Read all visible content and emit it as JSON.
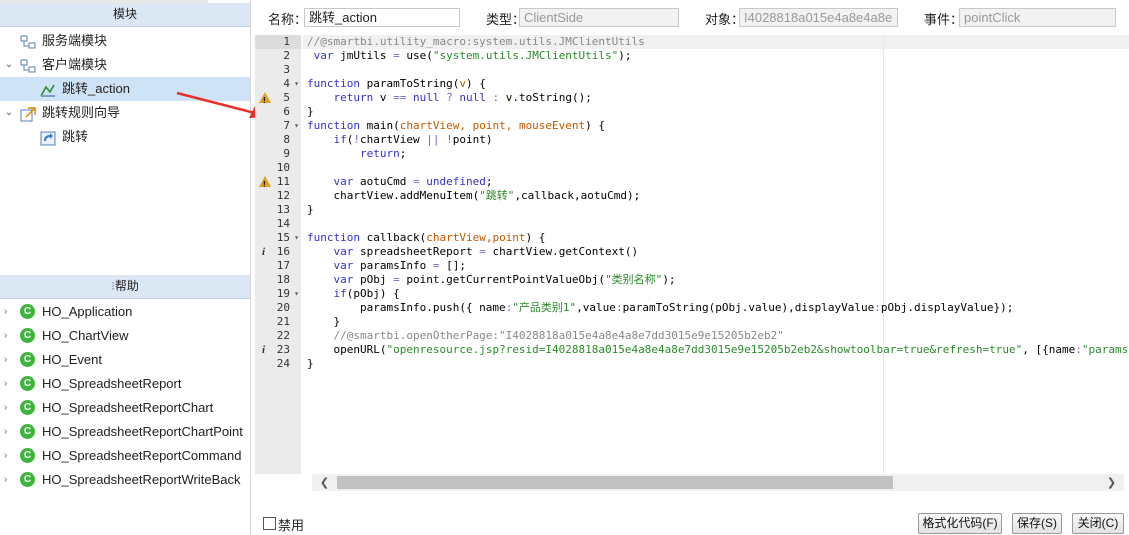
{
  "left_panel": {
    "module_header": "模块",
    "tree": [
      {
        "label": "服务端模块",
        "icon": "server-module-icon"
      },
      {
        "label": "客户端模块",
        "icon": "client-module-icon",
        "expanded": true
      },
      {
        "label": "跳转_action",
        "icon": "action-icon",
        "selected": true
      },
      {
        "label": "跳转规则向导",
        "icon": "wizard-icon",
        "expanded": true
      },
      {
        "label": "跳转",
        "icon": "jump-icon"
      }
    ],
    "help_header": "帮助",
    "help_items": [
      {
        "label": "HO_Application"
      },
      {
        "label": "HO_ChartView"
      },
      {
        "label": "HO_Event"
      },
      {
        "label": "HO_SpreadsheetReport"
      },
      {
        "label": "HO_SpreadsheetReportChart"
      },
      {
        "label": "HO_SpreadsheetReportChartPoint"
      },
      {
        "label": "HO_SpreadsheetReportCommand"
      },
      {
        "label": "HO_SpreadsheetReportWriteBack"
      }
    ],
    "help_badge": "C"
  },
  "fields": {
    "name_label": "名称：",
    "name_value": "跳转_action",
    "type_label": "类型：",
    "type_value": "ClientSide",
    "object_label": "对象：",
    "object_value": "I4028818a015e4a8e4a8e",
    "event_label": "事件：",
    "event_value": "pointClick"
  },
  "editor": {
    "lines": [
      {
        "n": "1",
        "text": "//@smartbi.utility_macro:system.utils.JMClientUtils"
      },
      {
        "n": "2",
        "text": " var jmUtils = use(\"system.utils.JMClientUtils\");"
      },
      {
        "n": "3",
        "text": ""
      },
      {
        "n": "4",
        "text": "function paramToString(v) {"
      },
      {
        "n": "5",
        "text": "    return v == null ? null : v.toString();"
      },
      {
        "n": "6",
        "text": "}"
      },
      {
        "n": "7",
        "text": "function main(chartView, point, mouseEvent) {"
      },
      {
        "n": "8",
        "text": "    if(!chartView || !point)"
      },
      {
        "n": "9",
        "text": "        return;"
      },
      {
        "n": "10",
        "text": ""
      },
      {
        "n": "11",
        "text": "    var aotuCmd = undefined;"
      },
      {
        "n": "12",
        "text": "    chartView.addMenuItem(\"跳转\",callback,aotuCmd);"
      },
      {
        "n": "13",
        "text": "}"
      },
      {
        "n": "14",
        "text": ""
      },
      {
        "n": "15",
        "text": "function callback(chartView,point) {"
      },
      {
        "n": "16",
        "text": "    var spreadsheetReport = chartView.getContext()"
      },
      {
        "n": "17",
        "text": "    var paramsInfo = [];"
      },
      {
        "n": "18",
        "text": "    var pObj = point.getCurrentPointValueObj(\"类别名称\");"
      },
      {
        "n": "19",
        "text": "    if(pObj) {"
      },
      {
        "n": "20",
        "text": "        paramsInfo.push({ name:\"产品类别1\",value:paramToString(pObj.value),displayValue:pObj.displayValue});"
      },
      {
        "n": "21",
        "text": "    }"
      },
      {
        "n": "22",
        "text": "    //@smartbi.openOtherPage:\"I4028818a015e4a8e4a8e7dd3015e9e15205b2eb2\""
      },
      {
        "n": "23",
        "text": "    openURL(\"openresource.jsp?resid=I4028818a015e4a8e4a8e7dd3015e9e15205b2eb2&showtoolbar=true&refresh=true\", [{name:\"paramsI"
      },
      {
        "n": "24",
        "text": "}"
      }
    ],
    "warning_lines": [
      "5",
      "11"
    ],
    "info_lines": [
      "16",
      "23"
    ],
    "fold_lines": [
      "4",
      "7",
      "15",
      "19"
    ]
  },
  "footer": {
    "disable_label": "禁用",
    "disable_checked": false,
    "format_button": "格式化代码(F)",
    "save_button": "保存(S)",
    "close_button": "关闭(C)"
  }
}
